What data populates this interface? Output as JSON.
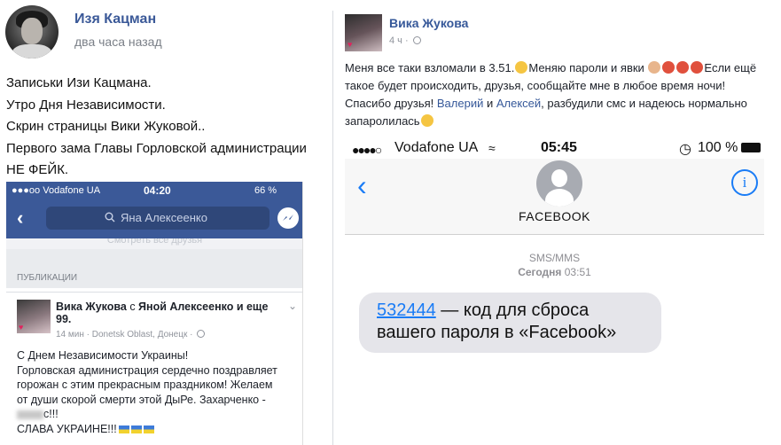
{
  "left_post": {
    "author": "Изя Кацман",
    "time": "два часа назад",
    "lines": [
      "Записьки Изи Кацмана.",
      "Утро Дня Независимости.",
      "Скрин страницы Вики Жуковой..",
      "Первого зама Главы Горловской администрации",
      "НЕ ФЕЙК."
    ],
    "screenshot": {
      "carrier": "●●●oo Vodafone UA",
      "clock": "04:20",
      "battery": "66 %",
      "search_query": "Яна Алексеенко",
      "faded_text": "Смотреть все друзья",
      "section_label": "ПУБЛИКАЦИИ",
      "post_author": "Вика Жукова",
      "post_relation": " с ",
      "post_with": "Яной Алексеенко и еще 99.",
      "post_meta": "14 мин · Donetsk Oblast, Донецк · ",
      "post_lines": [
        "С Днем Независимости Украины!",
        "Горловская администрация сердечно поздравляет",
        "горожан с этим прекрасным праздником! Желаем",
        "от души скорой смерти этой ДыРе. Захарченко -",
        "с!!!",
        "СЛАВА УКРАИНЕ!!!"
      ]
    }
  },
  "right_post": {
    "author": "Вика Жукова",
    "time": "4 ч · ",
    "text_1": "Меня все таки взломали в 3.51.",
    "text_2": "Меняю пароли и явки ",
    "text_3": "Если ещё такое будет происходить, друзья, сообщайте мне в любое время ночи! Спасибо друзья! ",
    "name_1": "Валерий",
    "text_4": " и ",
    "name_2": "Алексей",
    "text_5": ", разбудили смс и надеюсь нормально запаролилась",
    "sms": {
      "dots": "●●●●○",
      "carrier": "Vodafone UA",
      "clock": "05:45",
      "battery": "100 %",
      "contact": "FACEBOOK",
      "type": "SMS/MMS",
      "when": "Сегодня",
      "when_time": " 03:51",
      "code": "532444",
      "message": " — код для сброса вашего пароля в «Facebook»"
    }
  },
  "colors": {
    "fb_blue": "#3b5998",
    "ios_blue": "#1a7cf6",
    "bubble_gray": "#e5e5ea"
  },
  "icons": [
    "search-icon",
    "messenger-icon",
    "globe-icon",
    "wifi-icon",
    "alarm-icon",
    "battery-icon",
    "back-chevron-icon",
    "info-icon",
    "contact-avatar-icon"
  ]
}
